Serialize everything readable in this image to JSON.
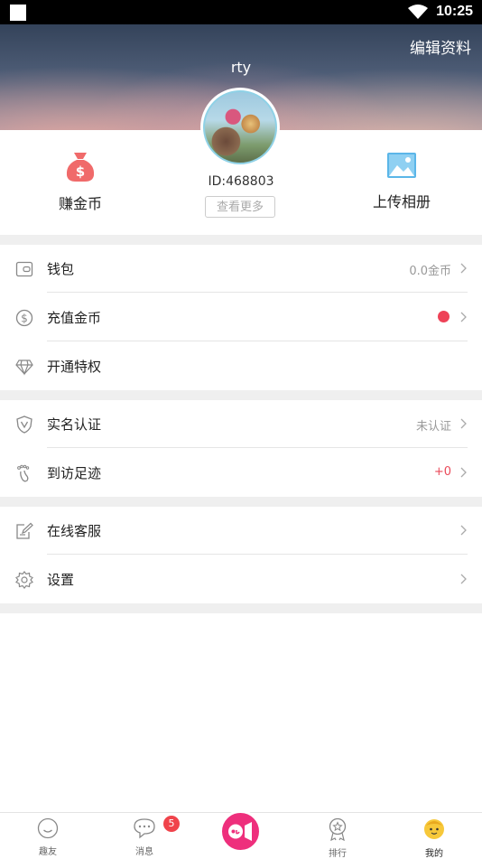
{
  "status": {
    "time": "10:25"
  },
  "header": {
    "edit_label": "编辑资料",
    "username": "rty"
  },
  "profile": {
    "id_text": "ID:468803",
    "more_label": "查看更多"
  },
  "features": {
    "earn_label": "赚金币",
    "upload_label": "上传相册"
  },
  "menu": {
    "wallet": {
      "label": "钱包",
      "value": "0.0金币"
    },
    "recharge": {
      "label": "充值金币"
    },
    "privilege": {
      "label": "开通特权"
    },
    "verify": {
      "label": "实名认证",
      "value": "未认证"
    },
    "footprint": {
      "label": "到访足迹",
      "value": "+0"
    },
    "service": {
      "label": "在线客服"
    },
    "settings": {
      "label": "设置"
    }
  },
  "tabbar": {
    "tabs": [
      {
        "label": "趣友",
        "icon": "smile-icon"
      },
      {
        "label": "消息",
        "icon": "chat-icon"
      },
      {
        "label": "排行",
        "icon": "medal-icon"
      },
      {
        "label": "我的",
        "icon": "face-icon"
      }
    ],
    "message_badge": "5",
    "center_icon": "video-call-icon",
    "active_tab": "我的"
  },
  "colors": {
    "accent_pink": "#ee2f7c",
    "badge_red": "#f0434b",
    "value_red": "#ea4a5a",
    "icon_blue": "#5bb6e8",
    "active_yellow": "#f7c83a"
  }
}
